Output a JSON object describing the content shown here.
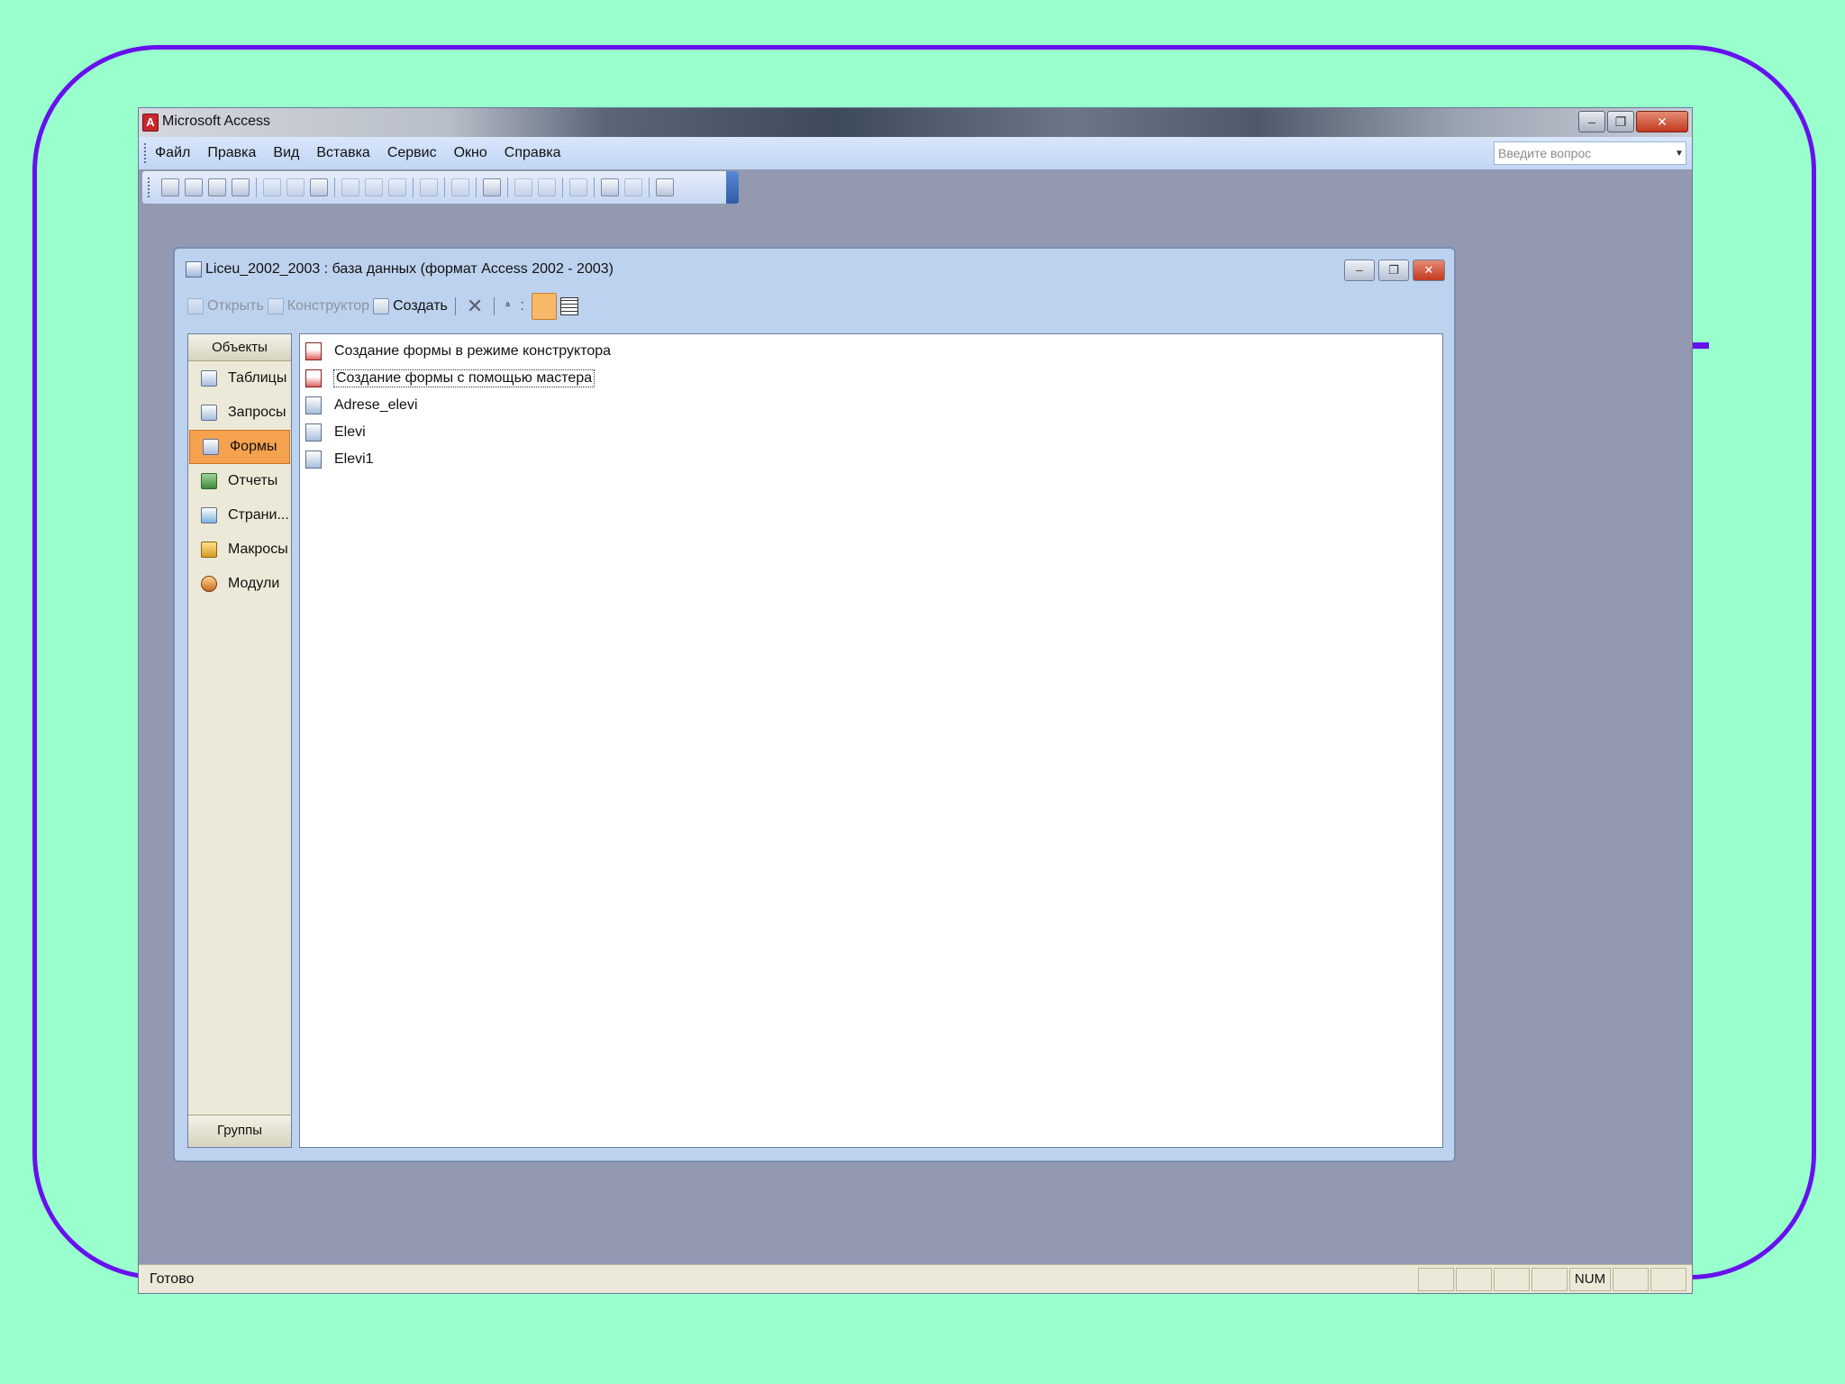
{
  "app": {
    "title": "Microsoft Access",
    "menu": [
      "Файл",
      "Правка",
      "Вид",
      "Вставка",
      "Сервис",
      "Окно",
      "Справка"
    ],
    "help_placeholder": "Введите вопрос"
  },
  "db_window": {
    "title": "Liceu_2002_2003 : база данных (формат Access 2002 - 2003)",
    "toolbar": {
      "open": "Открыть",
      "design": "Конструктор",
      "create": "Создать"
    },
    "objects_header": "Объекты",
    "objects": [
      "Таблицы",
      "Запросы",
      "Формы",
      "Отчеты",
      "Страни...",
      "Макросы",
      "Модули"
    ],
    "selected_object": "Формы",
    "groups_label": "Группы",
    "items": [
      "Создание формы в режиме конструктора",
      "Создание формы с помощью мастера",
      "Adrese_elevi",
      "Elevi",
      "Elevi1"
    ]
  },
  "status": {
    "text": "Готово",
    "num": "NUM"
  }
}
